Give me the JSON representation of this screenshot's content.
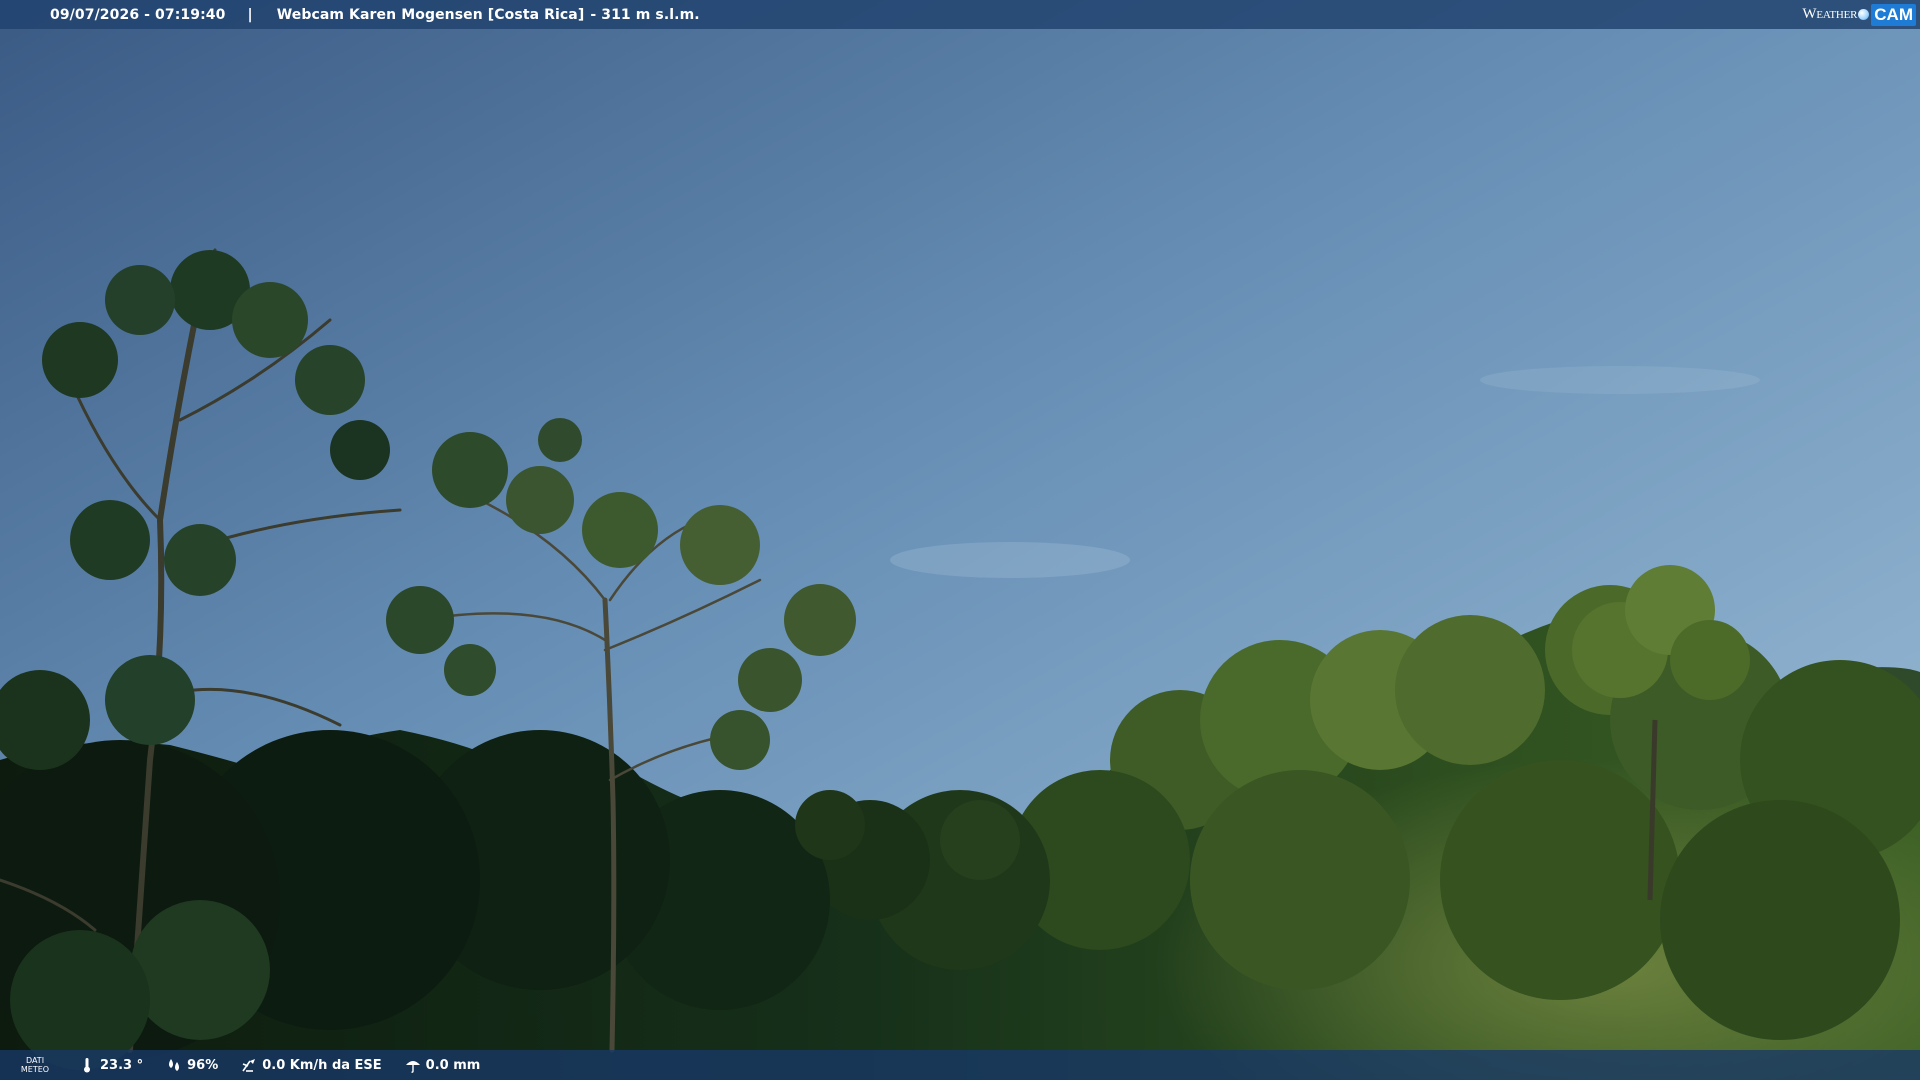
{
  "top_bar": {
    "datetime": "09/07/2026 - 07:19:40",
    "separator": "|",
    "webcam_title": "Webcam Karen Mogensen [Costa Rica]",
    "altitude": "- 311 m s.l.m."
  },
  "logo": {
    "weather": "Weather",
    "cam": "CAM"
  },
  "bottom_bar": {
    "label_line1": "DATI",
    "label_line2": "METEO",
    "temperature": "23.3 °",
    "humidity": "96%",
    "wind": "0.0 Km/h da ESE",
    "rain": "0.0 mm"
  },
  "icons": {
    "temperature": "thermometer-icon",
    "humidity": "humidity-drops-icon",
    "wind": "wind-vane-icon",
    "rain": "rain-umbrella-icon"
  },
  "colors": {
    "sky_top": "#3d5d86",
    "sky_bottom": "#8bb1cf",
    "foliage_dark": "#0e1f10",
    "foliage_mid": "#2a4a1e",
    "foliage_light": "#6f8a3a",
    "bar_bg": "#20426e"
  }
}
